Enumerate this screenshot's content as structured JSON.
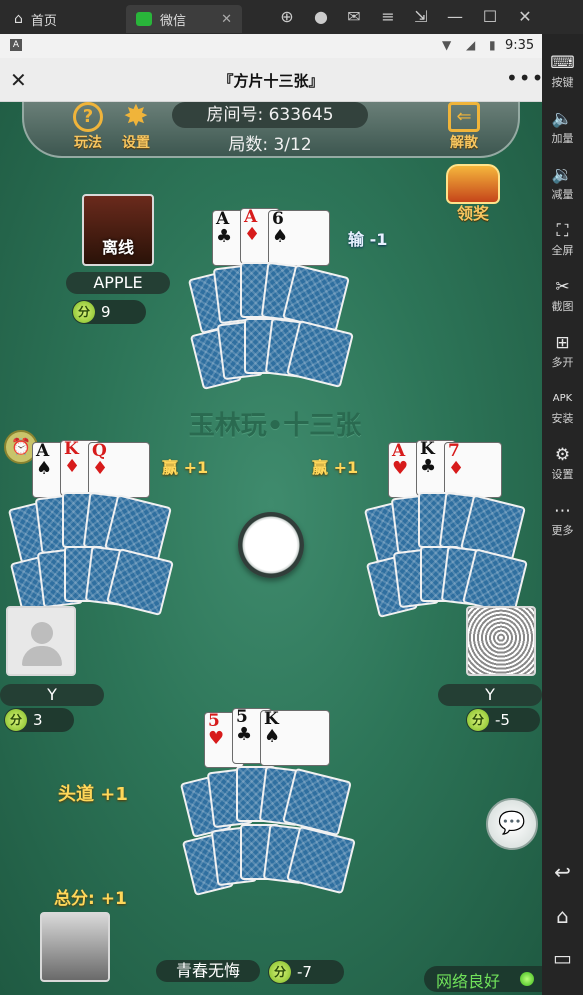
{
  "emulator": {
    "tabs": [
      {
        "label": "首页",
        "icon": "home-icon"
      },
      {
        "label": "微信",
        "icon": "wechat-icon"
      }
    ],
    "sidebar": [
      {
        "label": "按键",
        "icon": "keyboard-icon"
      },
      {
        "label": "加量",
        "icon": "volume-up-icon"
      },
      {
        "label": "减量",
        "icon": "volume-down-icon"
      },
      {
        "label": "全屏",
        "icon": "fullscreen-icon"
      },
      {
        "label": "截图",
        "icon": "scissors-icon"
      },
      {
        "label": "多开",
        "icon": "multi-open-icon"
      },
      {
        "label": "安装",
        "icon": "apk-icon"
      },
      {
        "label": "设置",
        "icon": "gear-icon"
      },
      {
        "label": "更多",
        "icon": "more-icon"
      }
    ]
  },
  "status_bar": {
    "time": "9:35"
  },
  "wechat": {
    "title": "『方片十三张』"
  },
  "game": {
    "room_label": "房间号: 633645",
    "round_label": "局数: 3/12",
    "rules_label": "玩法",
    "settings_label": "设置",
    "dissolve_label": "解散",
    "reward_label": "领奖",
    "watermark": "玉林玩•十三张",
    "network_label": "网络良好",
    "players": {
      "top": {
        "name": "APPLE",
        "score": "9",
        "avatar_label": "离线",
        "result": "输 -1",
        "cards": [
          {
            "rank": "A",
            "suit": "♣",
            "color": "black"
          },
          {
            "rank": "A",
            "suit": "♦",
            "color": "red"
          },
          {
            "rank": "6",
            "suit": "♠",
            "color": "black"
          }
        ]
      },
      "left": {
        "name": "Y",
        "score": "3",
        "result": "赢 +1",
        "cards": [
          {
            "rank": "A",
            "suit": "♠",
            "color": "black"
          },
          {
            "rank": "K",
            "suit": "♦",
            "color": "red"
          },
          {
            "rank": "Q",
            "suit": "♦",
            "color": "red"
          }
        ]
      },
      "right": {
        "name": "Y",
        "score": "-5",
        "result": "赢 +1",
        "cards": [
          {
            "rank": "A",
            "suit": "♥",
            "color": "red"
          },
          {
            "rank": "K",
            "suit": "♣",
            "color": "black"
          },
          {
            "rank": "7",
            "suit": "♦",
            "color": "red"
          }
        ]
      },
      "self": {
        "name": "青春无悔",
        "score": "-7",
        "round_result": "头道 +1",
        "total_label": "总分: +1",
        "cards": [
          {
            "rank": "5",
            "suit": "♥",
            "color": "red"
          },
          {
            "rank": "5",
            "suit": "♣",
            "color": "black"
          },
          {
            "rank": "K",
            "suit": "♠",
            "color": "black"
          }
        ]
      }
    },
    "fen_label": "分"
  }
}
